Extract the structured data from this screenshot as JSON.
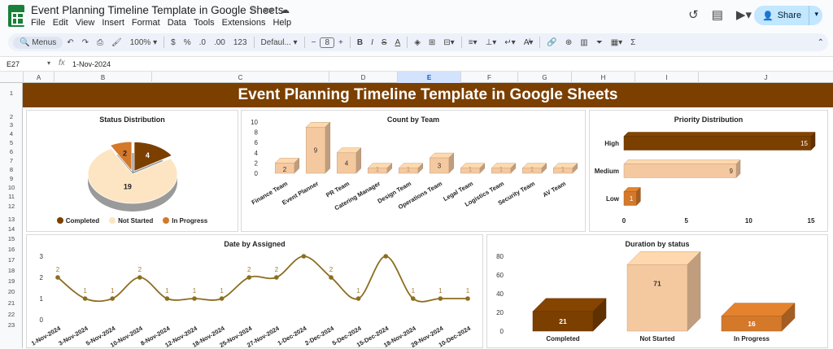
{
  "app": {
    "doc_title": "Event Planning Timeline Template in Google Sheets",
    "menu": [
      "File",
      "Edit",
      "View",
      "Insert",
      "Format",
      "Data",
      "Tools",
      "Extensions",
      "Help"
    ],
    "share_label": "Share"
  },
  "toolbar": {
    "menus_label": "Menus",
    "zoom": "100%",
    "currency": "$",
    "percent": "%",
    "dec_less": ".0",
    "dec_more": ".00",
    "num_format": "123",
    "font": "Defaul...",
    "font_size": "8",
    "bold": "B",
    "italic": "I",
    "strike": "S",
    "text_color": "A",
    "sum": "Σ"
  },
  "formula_bar": {
    "cell_ref": "E27",
    "fx": "fx",
    "value": "1-Nov-2024"
  },
  "columns": [
    "A",
    "B",
    "C",
    "D",
    "E",
    "F",
    "G",
    "H",
    "I",
    "J"
  ],
  "selected_column": "E",
  "rows": [
    "1",
    "2",
    "3",
    "4",
    "5",
    "6",
    "7",
    "8",
    "9",
    "10",
    "11",
    "12",
    "13",
    "14",
    "15",
    "16",
    "17",
    "18",
    "19",
    "20",
    "21",
    "22",
    "23"
  ],
  "banner_title": "Event Planning Timeline Template in Google Sheets",
  "charts": {
    "status": {
      "title": "Status Distribution",
      "legend": [
        "Completed",
        "Not Started",
        "In Progress"
      ]
    },
    "team": {
      "title": "Count by Team"
    },
    "priority": {
      "title": "Priority Distribution"
    },
    "date": {
      "title": "Date by Assigned"
    },
    "duration": {
      "title": "Duration by status"
    }
  },
  "colors": {
    "brown": "#7b3f00",
    "cream": "#fde5c3",
    "orange": "#d4782a",
    "peach": "#f5c9a0",
    "line": "#8c6d1f"
  },
  "chart_data": [
    {
      "type": "pie",
      "title": "Status Distribution",
      "categories": [
        "Completed",
        "Not Started",
        "In Progress"
      ],
      "values": [
        4,
        19,
        2
      ],
      "legend": "bottom"
    },
    {
      "type": "bar",
      "title": "Count by Team",
      "categories": [
        "Finance Team",
        "Event Planner",
        "PR Team",
        "Catering Manager",
        "Design Team",
        "Operations Team",
        "Legal Team",
        "Logistics Team",
        "Security Team",
        "AV Team"
      ],
      "values": [
        2,
        9,
        4,
        1,
        1,
        3,
        1,
        1,
        1,
        1
      ],
      "ylim": [
        0,
        10
      ],
      "yticks": [
        0,
        2,
        4,
        6,
        8,
        10
      ]
    },
    {
      "type": "bar",
      "orientation": "horizontal",
      "title": "Priority Distribution",
      "categories": [
        "High",
        "Medium",
        "Low"
      ],
      "values": [
        15,
        9,
        1
      ],
      "xlim": [
        0,
        15
      ],
      "xticks": [
        0,
        5,
        10,
        15
      ]
    },
    {
      "type": "line",
      "title": "Date by Assigned",
      "x": [
        "1-Nov-2024",
        "3-Nov-2024",
        "5-Nov-2024",
        "10-Nov-2024",
        "8-Nov-2024",
        "12-Nov-2024",
        "18-Nov-2024",
        "25-Nov-2024",
        "27-Nov-2024",
        "1-Dec-2024",
        "2-Dec-2024",
        "5-Dec-2024",
        "15-Dec-2024",
        "18-Nov-2024",
        "29-Nov-2024",
        "10-Dec-2024"
      ],
      "values": [
        2,
        1,
        1,
        2,
        1,
        1,
        1,
        2,
        2,
        3,
        2,
        1,
        3,
        1,
        1,
        1
      ],
      "ylim": [
        0,
        3
      ],
      "yticks": [
        0,
        1,
        2,
        3
      ]
    },
    {
      "type": "bar",
      "title": "Duration by status",
      "categories": [
        "Completed",
        "Not Started",
        "In Progress"
      ],
      "values": [
        21,
        71,
        16
      ],
      "ylim": [
        0,
        80
      ],
      "yticks": [
        0,
        20,
        40,
        60,
        80
      ]
    }
  ]
}
